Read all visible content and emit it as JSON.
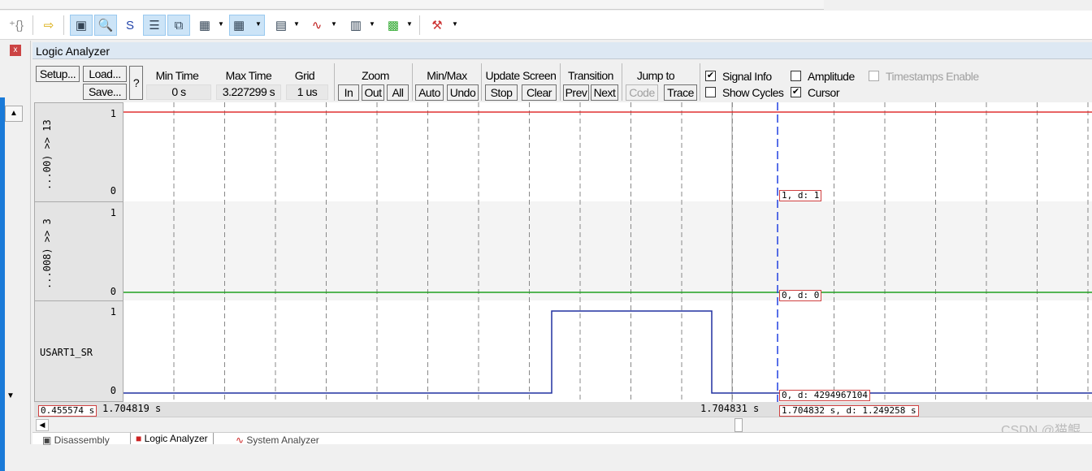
{
  "window": {
    "title": "Logic Analyzer"
  },
  "toolbar": {
    "icons": [
      "command-window-icon",
      "disassembly-icon",
      "symbols-icon",
      "registers-icon",
      "call-stack-icon",
      "watch-icon",
      "memory-icon",
      "serial-icon",
      "analysis-icon",
      "trace-icon",
      "system-viewer-icon",
      "toolbox-icon"
    ]
  },
  "controls": {
    "setup": "Setup...",
    "load": "Load...",
    "save": "Save...",
    "help": "?",
    "min_time_label": "Min Time",
    "min_time": "0 s",
    "max_time_label": "Max Time",
    "max_time": "3.227299 s",
    "grid_label": "Grid",
    "grid": "1 us",
    "zoom_label": "Zoom",
    "zoom_in": "In",
    "zoom_out": "Out",
    "zoom_all": "All",
    "minmax_label": "Min/Max",
    "auto": "Auto",
    "undo": "Undo",
    "update_label": "Update Screen",
    "stop": "Stop",
    "clear": "Clear",
    "transition_label": "Transition",
    "prev": "Prev",
    "next": "Next",
    "jump_label": "Jump to",
    "code": "Code",
    "trace": "Trace",
    "signal_info": "Signal Info",
    "signal_info_checked": true,
    "show_cycles": "Show Cycles",
    "show_cycles_checked": false,
    "amplitude": "Amplitude",
    "amplitude_checked": false,
    "cursor": "Cursor",
    "cursor_checked": true,
    "timestamps": "Timestamps Enable",
    "timestamps_checked": false
  },
  "signals": [
    {
      "name": "...00) >> 13",
      "max": "1",
      "min": "0",
      "color": "#e03030",
      "info": "1,   d: 1"
    },
    {
      "name": "...008) >> 3",
      "max": "1",
      "min": "0",
      "color": "#20a020",
      "info": "0,   d: 0"
    },
    {
      "name": "USART1_SR",
      "max": "1",
      "min": "0",
      "color": "#2030a0",
      "info": "0,   d: 4294967104"
    }
  ],
  "timeline": {
    "left_readout": "0.455574 s",
    "start_time": "1.704819 s",
    "marker_time": "1.704831 s",
    "cursor_readout": "1.704832 s,   d: 1.249258 s"
  },
  "tabs": [
    "Disassembly",
    "Logic Analyzer",
    "System Analyzer"
  ],
  "watermark": "CSDN @猫鲲"
}
